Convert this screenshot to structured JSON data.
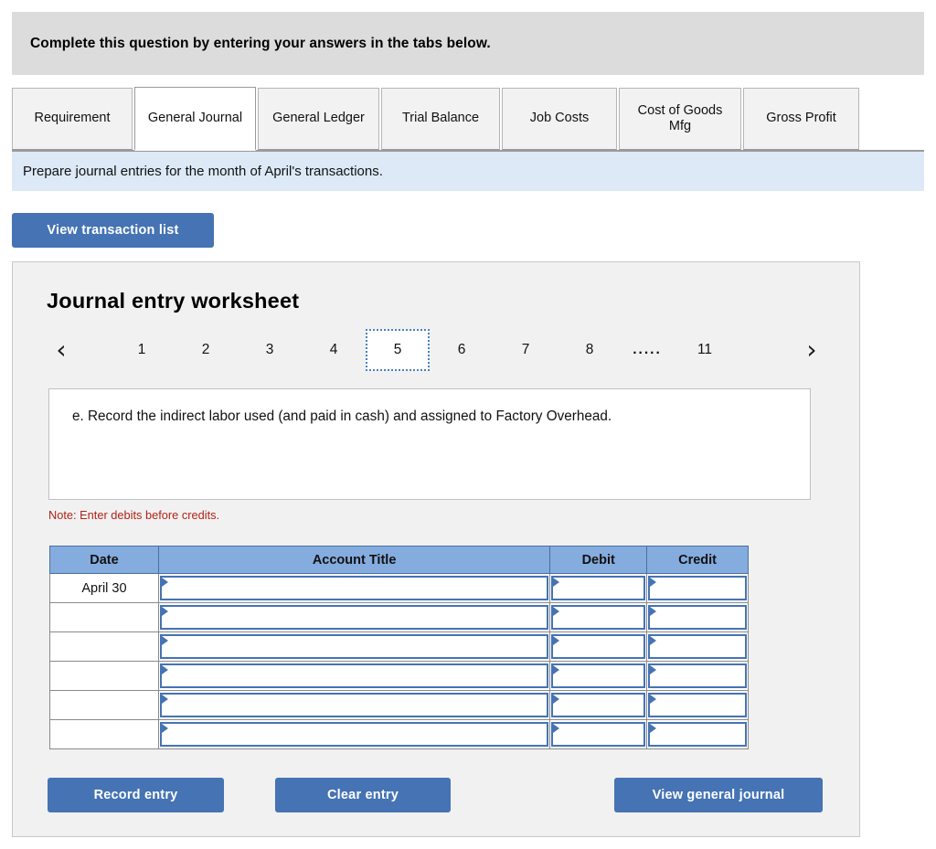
{
  "header": {
    "instruction": "Complete this question by entering your answers in the tabs below."
  },
  "tabs": [
    {
      "label": "Requirement",
      "active": false
    },
    {
      "label": "General Journal",
      "active": true
    },
    {
      "label": "General Ledger",
      "active": false
    },
    {
      "label": "Trial Balance",
      "active": false
    },
    {
      "label": "Job Costs",
      "active": false
    },
    {
      "label": "Cost of Goods Mfg",
      "active": false
    },
    {
      "label": "Gross Profit",
      "active": false
    }
  ],
  "requirement_banner": {
    "text": "Prepare journal entries for the month of April's transactions."
  },
  "toolbar": {
    "view_transaction_list_label": "View transaction list"
  },
  "worksheet": {
    "title": "Journal entry worksheet",
    "pager": {
      "prev_icon": "chevron-left-icon",
      "next_icon": "chevron-right-icon",
      "prev_glyph": "‹",
      "next_glyph": "›",
      "pages": [
        "1",
        "2",
        "3",
        "4",
        "5",
        "6",
        "7",
        "8"
      ],
      "ellipsis": ".....",
      "last_page": "11",
      "active_page": "5"
    },
    "prompt": "e. Record the indirect labor used (and paid in cash) and assigned to Factory Overhead.",
    "note": "Note: Enter debits before credits.",
    "table": {
      "columns": [
        "Date",
        "Account Title",
        "Debit",
        "Credit"
      ],
      "rows": [
        {
          "date": "April 30",
          "account_title": "",
          "debit": "",
          "credit": ""
        },
        {
          "date": "",
          "account_title": "",
          "debit": "",
          "credit": ""
        },
        {
          "date": "",
          "account_title": "",
          "debit": "",
          "credit": ""
        },
        {
          "date": "",
          "account_title": "",
          "debit": "",
          "credit": ""
        },
        {
          "date": "",
          "account_title": "",
          "debit": "",
          "credit": ""
        },
        {
          "date": "",
          "account_title": "",
          "debit": "",
          "credit": ""
        }
      ]
    },
    "buttons": {
      "record_entry": "Record entry",
      "clear_entry": "Clear entry",
      "view_general_journal": "View general journal"
    }
  },
  "colors": {
    "accent_blue": "#4573b3",
    "table_header_blue": "#85acde",
    "banner_blue": "#dde9f7",
    "top_band_gray": "#dcdcdc",
    "panel_gray": "#f1f1f1",
    "note_red": "#b02418"
  }
}
